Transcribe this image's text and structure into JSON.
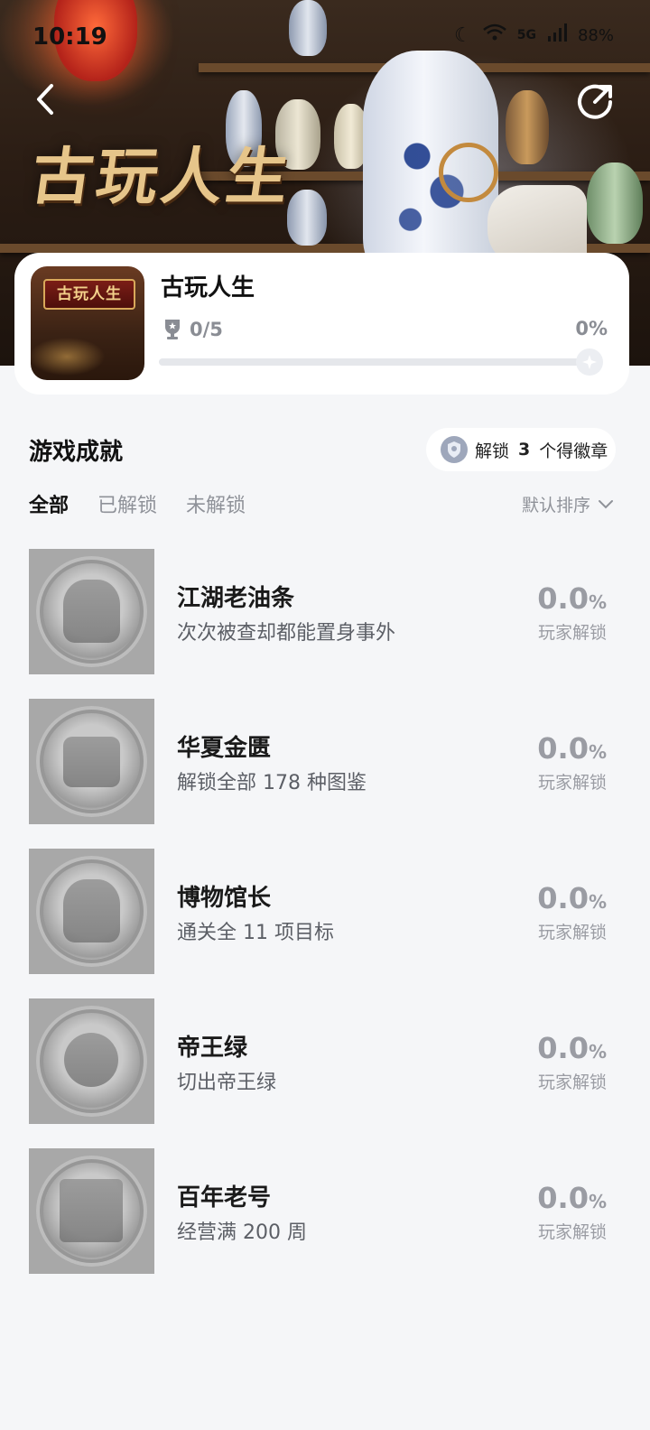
{
  "status_bar": {
    "time": "10:19",
    "network": "5G",
    "battery": "88%"
  },
  "hero": {
    "art_title": "古玩人生"
  },
  "game": {
    "thumb_text": "古玩人生",
    "name": "古玩人生",
    "trophies": "0/5",
    "progress_text": "0%",
    "progress_fraction": 0
  },
  "section": {
    "title": "游戏成就",
    "badge_prefix": "解锁",
    "badge_count": "3",
    "badge_suffix": "个得徽章"
  },
  "tabs": [
    {
      "label": "全部",
      "active": true
    },
    {
      "label": "已解锁",
      "active": false
    },
    {
      "label": "未解锁",
      "active": false
    }
  ],
  "sort": {
    "label": "默认排序"
  },
  "achievements": [
    {
      "name": "江湖老油条",
      "desc": "次次被查却都能置身事外",
      "rate": "0.0",
      "unit": "%",
      "rate_label": "玩家解锁"
    },
    {
      "name": "华夏金匮",
      "desc": "解锁全部 178 种图鉴",
      "rate": "0.0",
      "unit": "%",
      "rate_label": "玩家解锁"
    },
    {
      "name": "博物馆长",
      "desc": "通关全 11 项目标",
      "rate": "0.0",
      "unit": "%",
      "rate_label": "玩家解锁"
    },
    {
      "name": "帝王绿",
      "desc": "切出帝王绿",
      "rate": "0.0",
      "unit": "%",
      "rate_label": "玩家解锁"
    },
    {
      "name": "百年老号",
      "desc": "经营满 200 周",
      "rate": "0.0",
      "unit": "%",
      "rate_label": "玩家解锁"
    }
  ],
  "icons": {
    "back": "chevron-left-icon",
    "share": "share-icon",
    "trophy": "trophy-icon",
    "badge": "badge-icon",
    "sort": "chevron-down-icon"
  },
  "colors": {
    "background": "#f5f6f8",
    "card": "#ffffff",
    "muted_text": "#8f9299"
  }
}
